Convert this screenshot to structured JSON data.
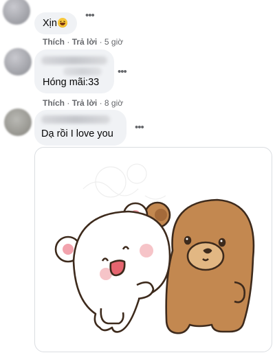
{
  "comments": [
    {
      "text": "Xịn",
      "emoji": "grinning-squinting-emoji",
      "actions": {
        "like": "Thích",
        "reply": "Trả lời",
        "time": "5 giờ"
      }
    },
    {
      "text": "Hóng mãi:33",
      "actions": {
        "like": "Thích",
        "reply": "Trả lời",
        "time": "8 giờ"
      }
    },
    {
      "text": "Dạ rồi I love you",
      "sticker": "hugging-bears-sticker"
    }
  ],
  "separator": "·",
  "more_icon": "more-horizontal-icon",
  "colors": {
    "bubble": "#f0f2f5",
    "meta": "#65676b",
    "text": "#050505",
    "border": "#dadde1"
  }
}
